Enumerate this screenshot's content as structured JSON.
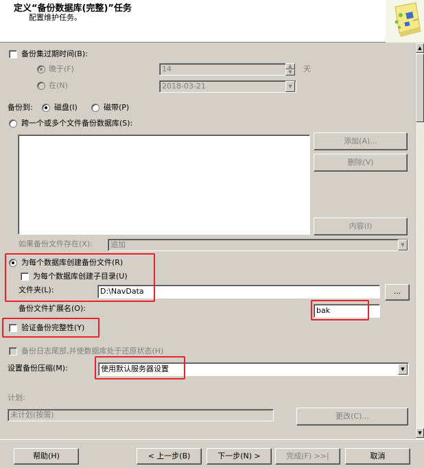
{
  "header": {
    "title": "定义“备份数据库(完整)”任务",
    "subtitle": "配置维护任务。"
  },
  "expire": {
    "label": "备份集过期时间(B):",
    "after_label": "晚于(F)",
    "after_value": "14",
    "after_unit": "天",
    "on_label": "在(N)",
    "on_value": "2018-03-21"
  },
  "backup_to": {
    "label": "备份到:",
    "disk": "磁盘(I)",
    "tape": "磁带(P)"
  },
  "span_files": {
    "label": "跨一个或多个文件备份数据库(S):",
    "add": "添加(A)...",
    "remove": "删除(V)",
    "contents": "内容(I)",
    "if_exists_label": "如果备份文件存在(X):",
    "if_exists_value": "追加"
  },
  "per_db": {
    "label": "为每个数据库创建备份文件(R)",
    "subdir_label": "为每个数据库创建子目录(U)",
    "folder_label": "文件夹(L):",
    "folder_value": "D:\\NavData",
    "browse": "...",
    "ext_label": "备份文件扩展名(O):",
    "ext_value": "bak"
  },
  "verify": {
    "label": "验证备份完整性(Y)"
  },
  "tail_log": {
    "label": "备份日志尾部,并使数据库处于还原状态(H)"
  },
  "compression": {
    "label": "设置备份压缩(M):",
    "value": "使用默认服务器设置"
  },
  "schedule": {
    "label": "计划:",
    "value": "未计划(按需)",
    "change": "更改(C)..."
  },
  "footer": {
    "help": "帮助(H)",
    "back": "< 上一步(B)",
    "next": "下一步(N) >",
    "finish": "完成(F) >>|",
    "cancel": "取消"
  },
  "colors": {
    "highlight_border": "#e8212a",
    "dialog_bg": "#d4d0c8"
  }
}
